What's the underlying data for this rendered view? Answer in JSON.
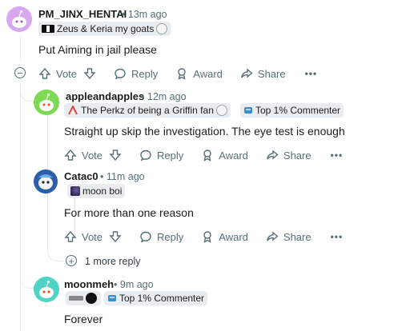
{
  "comments": [
    {
      "username": "PM_JINX_HENTAI",
      "time": "13m ago",
      "flair_text": "Zeus & Keria my goats",
      "body": "Put Aiming in jail please"
    },
    {
      "username": "appleandapples",
      "time": "12m ago",
      "flair_text": "The Perkz of being a Griffin fan",
      "badge": "Top 1% Commenter",
      "body": "Straight up skip the investigation. The eye test is enough"
    },
    {
      "username": "Catac0",
      "time": "11m ago",
      "flair_text": "moon boi",
      "body": "For more than one reason"
    },
    {
      "username": "moonmeh",
      "time": "9m ago",
      "badge": "Top 1% Commenter",
      "body": "Forever"
    }
  ],
  "actions": {
    "vote": "Vote",
    "reply": "Reply",
    "award": "Award",
    "share": "Share",
    "more": "•••"
  },
  "more_replies": "1 more reply",
  "separator": "•",
  "icons": [
    "collapse-icon",
    "upvote-icon",
    "downvote-icon",
    "reply-icon",
    "award-icon",
    "share-icon",
    "more-icon",
    "expand-icon",
    "badge-icon"
  ],
  "colors": {
    "avatar_purple": "#d8a7f0",
    "avatar_green": "#7ed957",
    "avatar_teal": "#4fd3c4",
    "avatar_blue": "#3f7fd9",
    "badge_blue": "#3b8ec9"
  }
}
